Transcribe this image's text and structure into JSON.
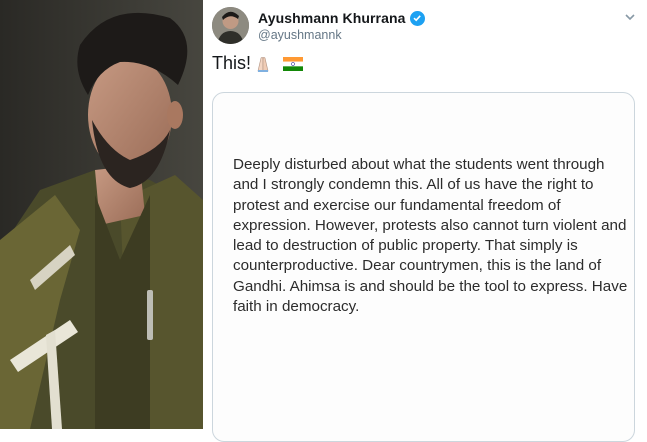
{
  "tweet": {
    "display_name": "Ayushmann Khurrana",
    "handle": "@ayushmannk",
    "text": "This!",
    "emoji": [
      "folded-hands-emoji",
      "india-flag-emoji"
    ],
    "image_text": "Deeply disturbed about what the students went through and I strongly condemn this. All of us have the right to protest and exercise our fundamental freedom of expression. However, protests also cannot turn violent and lead to destruction of public property. That simply is counterproductive. Dear countrymen, this is the land of Gandhi. Ahimsa is and should be the tool to express. Have faith in democracy."
  },
  "icons": {
    "verified": "verified-badge-icon",
    "more": "chevron-down-icon"
  },
  "colors": {
    "verified": "#1da1f2",
    "name": "#14171a",
    "handle": "#657786",
    "card_border": "#ccd6dd"
  }
}
